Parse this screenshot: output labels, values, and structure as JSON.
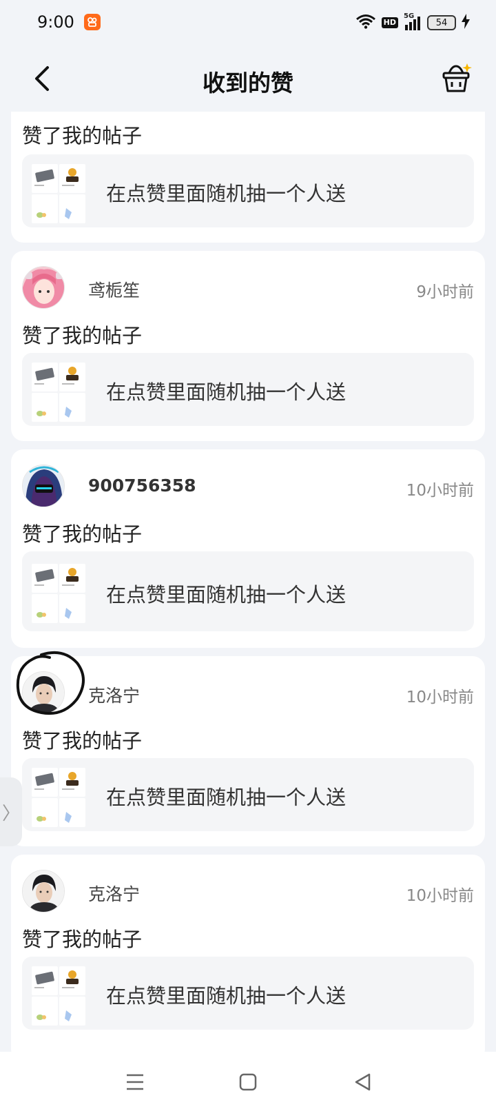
{
  "status_bar": {
    "time": "9:00",
    "app_icon": "kuaishou-icon",
    "hd_label": "HD",
    "network_label": "5G",
    "battery_level": "54"
  },
  "header": {
    "title": "收到的赞",
    "back_icon": "back-chevron-icon",
    "basket_icon": "basket-icon"
  },
  "items": [
    {
      "username": "",
      "time": "",
      "action": "赞了我的帖子",
      "post_title": "在点赞里面随机抽一个人送"
    },
    {
      "username": "鸢栀笙",
      "time": "9小时前",
      "action": "赞了我的帖子",
      "post_title": "在点赞里面随机抽一个人送"
    },
    {
      "username": "900756358",
      "time": "10小时前",
      "action": "赞了我的帖子",
      "post_title": "在点赞里面随机抽一个人送"
    },
    {
      "username": "克洛宁",
      "time": "10小时前",
      "action": "赞了我的帖子",
      "post_title": "在点赞里面随机抽一个人送"
    },
    {
      "username": "克洛宁",
      "time": "10小时前",
      "action": "赞了我的帖子",
      "post_title": "在点赞里面随机抽一个人送"
    }
  ],
  "side_handle": "〉",
  "nav_bar": {
    "menu_icon": "menu-icon",
    "home_icon": "home-square-icon",
    "back_icon": "back-triangle-icon"
  }
}
